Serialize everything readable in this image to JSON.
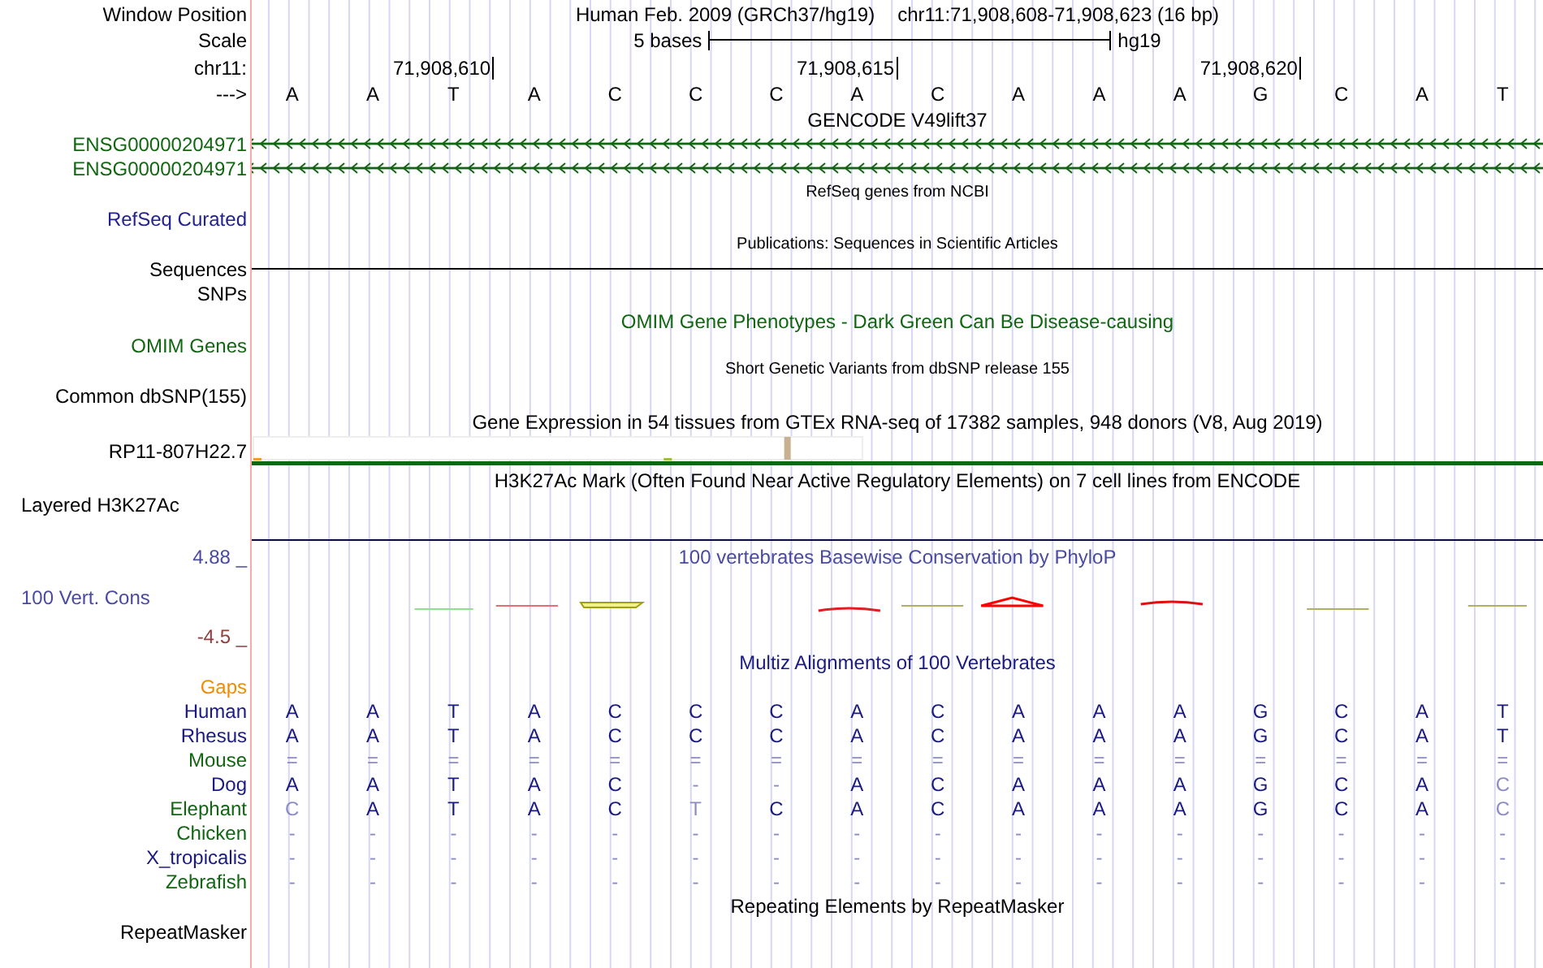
{
  "header": {
    "window_position_label": "Window Position",
    "assembly": "Human Feb. 2009 (GRCh37/hg19)",
    "position": "chr11:71,908,608-71,908,623 (16 bp)",
    "scale_label": "Scale",
    "scale_text": "5 bases",
    "scale_db": "hg19",
    "chrom_label": "chr11:",
    "ticks": [
      "71,908,610",
      "71,908,615",
      "71,908,620"
    ],
    "strand_label": "--->",
    "bases": [
      "A",
      "A",
      "T",
      "A",
      "C",
      "C",
      "C",
      "A",
      "C",
      "A",
      "A",
      "A",
      "G",
      "C",
      "A",
      "T"
    ]
  },
  "gencode": {
    "title": "GENCODE V49lift37",
    "genes": [
      "ENSG00000204971",
      "ENSG00000204971"
    ]
  },
  "refseq": {
    "title": "RefSeq genes from NCBI",
    "label": "RefSeq Curated"
  },
  "publications": {
    "title": "Publications: Sequences in Scientific Articles",
    "label": "Sequences",
    "sublabel": "SNPs"
  },
  "omim": {
    "title": "OMIM Gene Phenotypes - Dark Green Can Be Disease-causing",
    "label": "OMIM Genes"
  },
  "dbsnp": {
    "title": "Short Genetic Variants from dbSNP release 155",
    "label": "Common dbSNP(155)"
  },
  "gtex": {
    "title": "Gene Expression in 54 tissues from GTEx RNA-seq of 17382 samples, 948 donors (V8, Aug 2019)",
    "label": "RP11-807H22.7"
  },
  "h3k27ac": {
    "title": "H3K27Ac Mark (Often Found Near Active Regulatory Elements) on 7 cell lines from ENCODE",
    "label": "Layered H3K27Ac"
  },
  "phylop": {
    "title": "100 vertebrates Basewise Conservation by PhyloP",
    "label": "100 Vert. Cons",
    "max": "4.88 _",
    "min": "-4.5 _"
  },
  "multiz": {
    "title": "Multiz Alignments of 100 Vertebrates",
    "gaps_label": "Gaps",
    "species": [
      {
        "name": "Human",
        "color": "#1a1a80",
        "bases": [
          {
            "b": "A",
            "faint": false
          },
          {
            "b": "A",
            "faint": false
          },
          {
            "b": "T",
            "faint": false
          },
          {
            "b": "A",
            "faint": false
          },
          {
            "b": "C",
            "faint": false
          },
          {
            "b": "C",
            "faint": false
          },
          {
            "b": "C",
            "faint": false
          },
          {
            "b": "A",
            "faint": false
          },
          {
            "b": "C",
            "faint": false
          },
          {
            "b": "A",
            "faint": false
          },
          {
            "b": "A",
            "faint": false
          },
          {
            "b": "A",
            "faint": false
          },
          {
            "b": "G",
            "faint": false
          },
          {
            "b": "C",
            "faint": false
          },
          {
            "b": "A",
            "faint": false
          },
          {
            "b": "T",
            "faint": false
          }
        ]
      },
      {
        "name": "Rhesus",
        "color": "#1a1a80",
        "bases": [
          {
            "b": "A",
            "faint": false
          },
          {
            "b": "A",
            "faint": false
          },
          {
            "b": "T",
            "faint": false
          },
          {
            "b": "A",
            "faint": false
          },
          {
            "b": "C",
            "faint": false
          },
          {
            "b": "C",
            "faint": false
          },
          {
            "b": "C",
            "faint": false
          },
          {
            "b": "A",
            "faint": false
          },
          {
            "b": "C",
            "faint": false
          },
          {
            "b": "A",
            "faint": false
          },
          {
            "b": "A",
            "faint": false
          },
          {
            "b": "A",
            "faint": false
          },
          {
            "b": "G",
            "faint": false
          },
          {
            "b": "C",
            "faint": false
          },
          {
            "b": "A",
            "faint": false
          },
          {
            "b": "T",
            "faint": false
          }
        ]
      },
      {
        "name": "Mouse",
        "color": "#116611",
        "bases": [
          {
            "b": "=",
            "faint": true
          },
          {
            "b": "=",
            "faint": true
          },
          {
            "b": "=",
            "faint": true
          },
          {
            "b": "=",
            "faint": true
          },
          {
            "b": "=",
            "faint": true
          },
          {
            "b": "=",
            "faint": true
          },
          {
            "b": "=",
            "faint": true
          },
          {
            "b": "=",
            "faint": true
          },
          {
            "b": "=",
            "faint": true
          },
          {
            "b": "=",
            "faint": true
          },
          {
            "b": "=",
            "faint": true
          },
          {
            "b": "=",
            "faint": true
          },
          {
            "b": "=",
            "faint": true
          },
          {
            "b": "=",
            "faint": true
          },
          {
            "b": "=",
            "faint": true
          },
          {
            "b": "=",
            "faint": true
          }
        ]
      },
      {
        "name": "Dog",
        "color": "#1a1a80",
        "bases": [
          {
            "b": "A",
            "faint": false
          },
          {
            "b": "A",
            "faint": false
          },
          {
            "b": "T",
            "faint": false
          },
          {
            "b": "A",
            "faint": false
          },
          {
            "b": "C",
            "faint": false
          },
          {
            "b": "-",
            "faint": true
          },
          {
            "b": "-",
            "faint": true
          },
          {
            "b": "A",
            "faint": false
          },
          {
            "b": "C",
            "faint": false
          },
          {
            "b": "A",
            "faint": false
          },
          {
            "b": "A",
            "faint": false
          },
          {
            "b": "A",
            "faint": false
          },
          {
            "b": "G",
            "faint": false
          },
          {
            "b": "C",
            "faint": false
          },
          {
            "b": "A",
            "faint": false
          },
          {
            "b": "C",
            "faint": true
          }
        ]
      },
      {
        "name": "Elephant",
        "color": "#116611",
        "bases": [
          {
            "b": "C",
            "faint": true
          },
          {
            "b": "A",
            "faint": false
          },
          {
            "b": "T",
            "faint": false
          },
          {
            "b": "A",
            "faint": false
          },
          {
            "b": "C",
            "faint": false
          },
          {
            "b": "T",
            "faint": true
          },
          {
            "b": "C",
            "faint": false
          },
          {
            "b": "A",
            "faint": false
          },
          {
            "b": "C",
            "faint": false
          },
          {
            "b": "A",
            "faint": false
          },
          {
            "b": "A",
            "faint": false
          },
          {
            "b": "A",
            "faint": false
          },
          {
            "b": "G",
            "faint": false
          },
          {
            "b": "C",
            "faint": false
          },
          {
            "b": "A",
            "faint": false
          },
          {
            "b": "C",
            "faint": true
          }
        ]
      },
      {
        "name": "Chicken",
        "color": "#116611",
        "bases": [
          {
            "b": "-",
            "faint": true
          },
          {
            "b": "-",
            "faint": true
          },
          {
            "b": "-",
            "faint": true
          },
          {
            "b": "-",
            "faint": true
          },
          {
            "b": "-",
            "faint": true
          },
          {
            "b": "-",
            "faint": true
          },
          {
            "b": "-",
            "faint": true
          },
          {
            "b": "-",
            "faint": true
          },
          {
            "b": "-",
            "faint": true
          },
          {
            "b": "-",
            "faint": true
          },
          {
            "b": "-",
            "faint": true
          },
          {
            "b": "-",
            "faint": true
          },
          {
            "b": "-",
            "faint": true
          },
          {
            "b": "-",
            "faint": true
          },
          {
            "b": "-",
            "faint": true
          },
          {
            "b": "-",
            "faint": true
          }
        ]
      },
      {
        "name": "X_tropicalis",
        "color": "#1a1a80",
        "bases": [
          {
            "b": "-",
            "faint": true
          },
          {
            "b": "-",
            "faint": true
          },
          {
            "b": "-",
            "faint": true
          },
          {
            "b": "-",
            "faint": true
          },
          {
            "b": "-",
            "faint": true
          },
          {
            "b": "-",
            "faint": true
          },
          {
            "b": "-",
            "faint": true
          },
          {
            "b": "-",
            "faint": true
          },
          {
            "b": "-",
            "faint": true
          },
          {
            "b": "-",
            "faint": true
          },
          {
            "b": "-",
            "faint": true
          },
          {
            "b": "-",
            "faint": true
          },
          {
            "b": "-",
            "faint": true
          },
          {
            "b": "-",
            "faint": true
          },
          {
            "b": "-",
            "faint": true
          },
          {
            "b": "-",
            "faint": true
          }
        ]
      },
      {
        "name": "Zebrafish",
        "color": "#116611",
        "bases": [
          {
            "b": "-",
            "faint": true
          },
          {
            "b": "-",
            "faint": true
          },
          {
            "b": "-",
            "faint": true
          },
          {
            "b": "-",
            "faint": true
          },
          {
            "b": "-",
            "faint": true
          },
          {
            "b": "-",
            "faint": true
          },
          {
            "b": "-",
            "faint": true
          },
          {
            "b": "-",
            "faint": true
          },
          {
            "b": "-",
            "faint": true
          },
          {
            "b": "-",
            "faint": true
          },
          {
            "b": "-",
            "faint": true
          },
          {
            "b": "-",
            "faint": true
          },
          {
            "b": "-",
            "faint": true
          },
          {
            "b": "-",
            "faint": true
          },
          {
            "b": "-",
            "faint": true
          },
          {
            "b": "-",
            "faint": true
          }
        ]
      }
    ]
  },
  "repeatmasker": {
    "title": "Repeating Elements by RepeatMasker",
    "label": "RepeatMasker"
  }
}
